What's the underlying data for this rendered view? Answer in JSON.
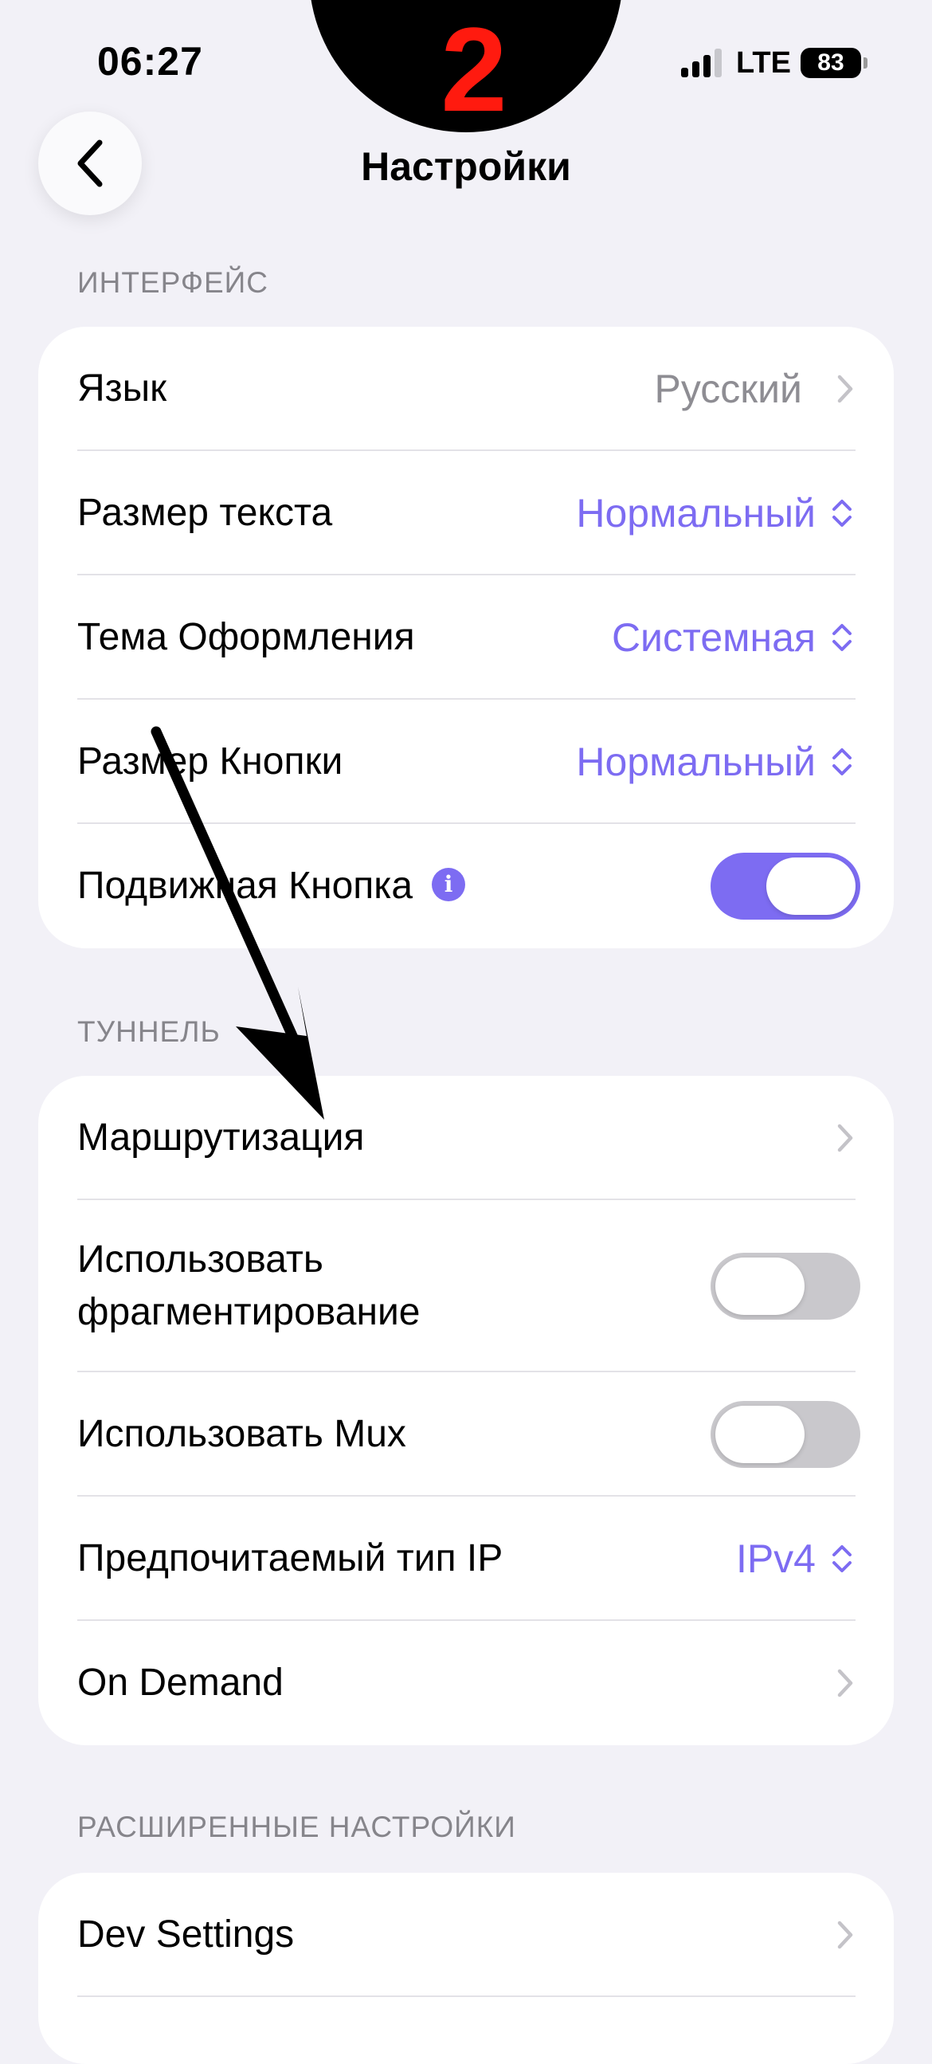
{
  "status_bar": {
    "time": "06:27",
    "network": "LTE",
    "battery": "83"
  },
  "annotation": {
    "step_number": "2"
  },
  "nav": {
    "title": "Настройки"
  },
  "sections": {
    "interface": {
      "header": "ИНТЕРФЕЙС",
      "language": {
        "label": "Язык",
        "value": "Русский"
      },
      "text_size": {
        "label": "Размер текста",
        "value": "Нормальный"
      },
      "theme": {
        "label": "Тема Оформления",
        "value": "Системная"
      },
      "button_size": {
        "label": "Размер Кнопки",
        "value": "Нормальный"
      },
      "floating_button": {
        "label": "Подвижная Кнопка",
        "info": "i",
        "enabled": true
      }
    },
    "tunnel": {
      "header": "ТУННЕЛЬ",
      "routing": {
        "label": "Маршрутизация"
      },
      "fragmentation": {
        "label_line1": "Использовать",
        "label_line2": "фрагментирование",
        "enabled": false
      },
      "mux": {
        "label": "Использовать Mux",
        "enabled": false
      },
      "ip_type": {
        "label": "Предпочитаемый тип IP",
        "value": "IPv4"
      },
      "on_demand": {
        "label": "On Demand"
      }
    },
    "advanced": {
      "header": "РАСШИРЕННЫЕ НАСТРОЙКИ",
      "dev_settings": {
        "label": "Dev Settings"
      }
    }
  },
  "colors": {
    "accent": "#7d6cf2",
    "background": "#f2f1f7",
    "annotation_red": "#ff1a0f"
  }
}
